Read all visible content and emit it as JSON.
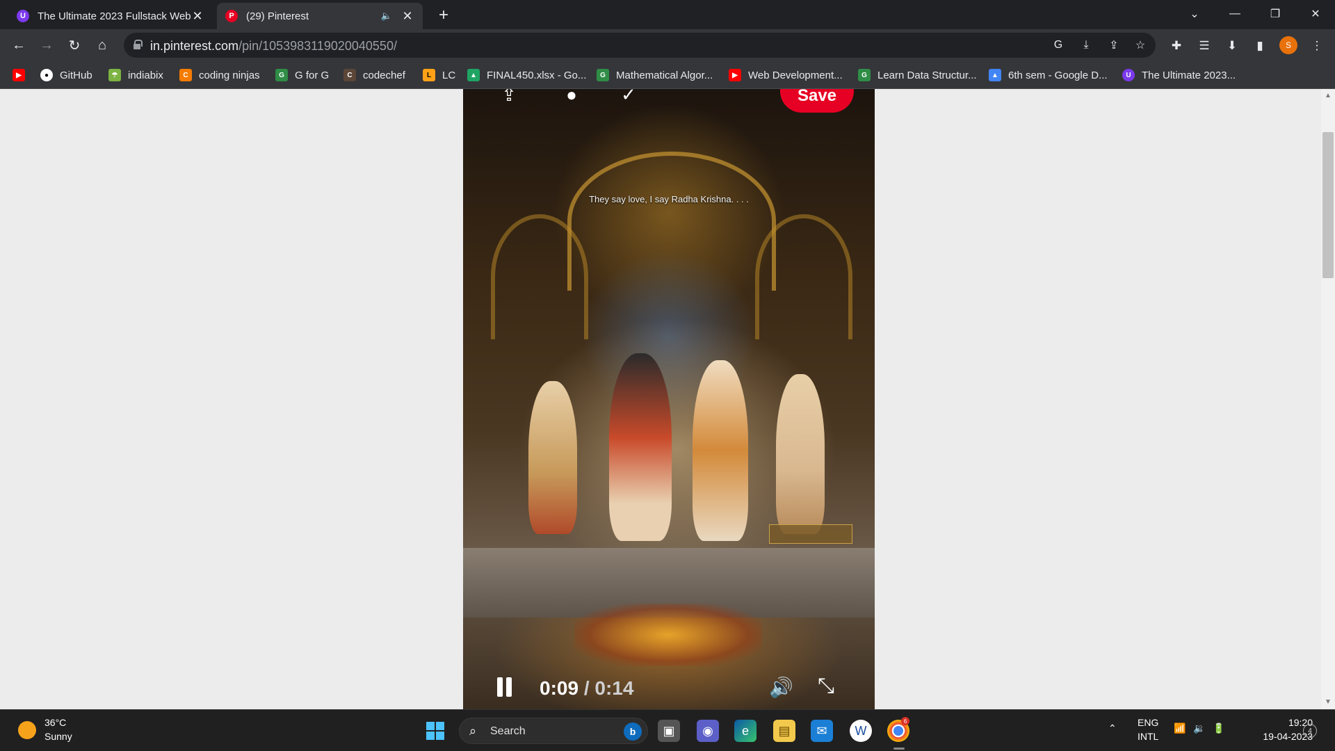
{
  "browser": {
    "tabs": [
      {
        "title": "The Ultimate 2023 Fullstack Web",
        "icon": "U",
        "icon_color": "#7c3aed"
      },
      {
        "title": "(29) Pinterest",
        "icon": "P",
        "icon_color": "#e60023"
      }
    ],
    "url_host": "in.pinterest.com",
    "url_path": "/pin/1053983119020040550/",
    "profile_initial": "S"
  },
  "bookmarks": [
    {
      "label": "",
      "icon": "▶",
      "color": "#ff0000"
    },
    {
      "label": "GitHub",
      "icon": "●",
      "color": "#ffffff"
    },
    {
      "label": "indiabix",
      "icon": "☂",
      "color": "#7cb342"
    },
    {
      "label": "coding ninjas",
      "icon": "C",
      "color": "#f57c00"
    },
    {
      "label": "G for G",
      "icon": "G",
      "color": "#2f8d46"
    },
    {
      "label": "codechef",
      "icon": "C",
      "color": "#5b4638"
    },
    {
      "label": "LC",
      "icon": "L",
      "color": "#ffa116"
    },
    {
      "label": "FINAL450.xlsx - Go...",
      "icon": "▲",
      "color": "#1fa463"
    },
    {
      "label": "Mathematical Algor...",
      "icon": "G",
      "color": "#2f8d46"
    },
    {
      "label": "Web Development...",
      "icon": "▶",
      "color": "#ff0000"
    },
    {
      "label": "Learn Data Structur...",
      "icon": "G",
      "color": "#2f8d46"
    },
    {
      "label": "6th sem - Google D...",
      "icon": "▲",
      "color": "#4285f4"
    },
    {
      "label": "The Ultimate 2023...",
      "icon": "U",
      "color": "#7c3aed"
    }
  ],
  "pin": {
    "save_label": "Save",
    "caption": "They say love, I say Radha Krishna. . . .",
    "current_time": "0:09",
    "separator": "/",
    "total_time": "0:14"
  },
  "taskbar": {
    "weather_temp": "36°C",
    "weather_desc": "Sunny",
    "search_label": "Search",
    "lang": "ENG",
    "layout": "INTL",
    "time": "19:20",
    "date": "19-04-2023",
    "notifications": "4",
    "chrome_badge": "6"
  }
}
